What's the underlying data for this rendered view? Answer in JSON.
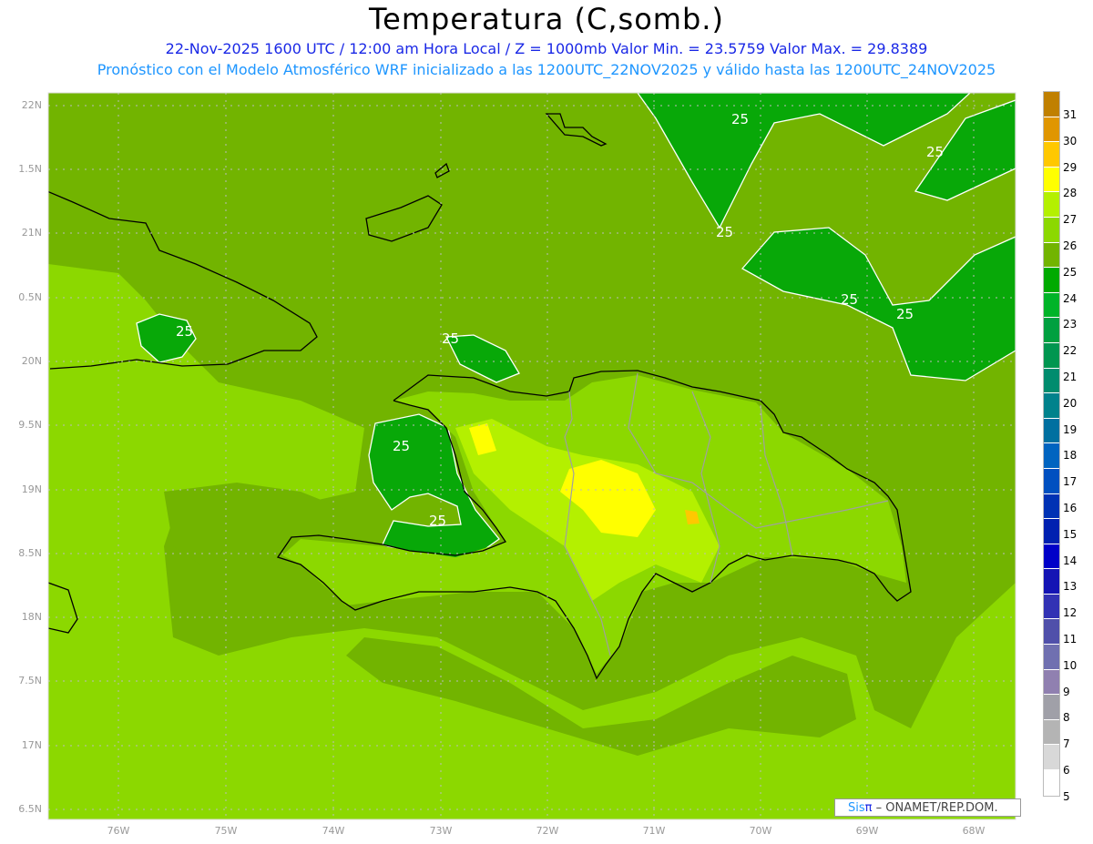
{
  "title": "Temperatura (C,somb.)",
  "subtitle_line1": "22-Nov-2025 1600 UTC / 12:00 am Hora Local / Z = 1000mb   Valor Min. = 23.5759   Valor Max. = 29.8389",
  "subtitle_line2": "Pronóstico con el Modelo Atmosférico WRF inicializado a las 1200UTC_22NOV2025 y válido hasta las  1200UTC_24NOV2025",
  "lat_labels": [
    "22N",
    "1.5N",
    "21N",
    "0.5N",
    "20N",
    "9.5N",
    "19N",
    "8.5N",
    "18N",
    "7.5N",
    "17N",
    "6.5N"
  ],
  "lon_labels": [
    "76W",
    "75W",
    "74W",
    "73W",
    "72W",
    "71W",
    "70W",
    "69W",
    "68W"
  ],
  "contour_label": "25",
  "colorbar": {
    "labels": [
      "31",
      "30",
      "29",
      "28",
      "27",
      "26",
      "25",
      "24",
      "23",
      "22",
      "21",
      "20",
      "19",
      "18",
      "17",
      "16",
      "15",
      "14",
      "13",
      "12",
      "11",
      "10",
      "9",
      "8",
      "7",
      "6",
      "5"
    ],
    "colors": [
      "#c08000",
      "#e09600",
      "#ffc800",
      "#ffff00",
      "#b4f000",
      "#8cd800",
      "#72b400",
      "#00aa00",
      "#00b428",
      "#00a040",
      "#009650",
      "#008c6e",
      "#00828c",
      "#0070a0",
      "#0064c0",
      "#0050c0",
      "#0032b4",
      "#0020b0",
      "#0000c8",
      "#1414b4",
      "#3232b4",
      "#5050aa",
      "#7070b0",
      "#9080b0",
      "#a0a0a8",
      "#b4b4b4",
      "#d8d8d8",
      "#ffffff"
    ]
  },
  "credit": {
    "sis": "Sis",
    "pi": "π",
    "rest": " –  ONAMET/REP.DOM."
  }
}
